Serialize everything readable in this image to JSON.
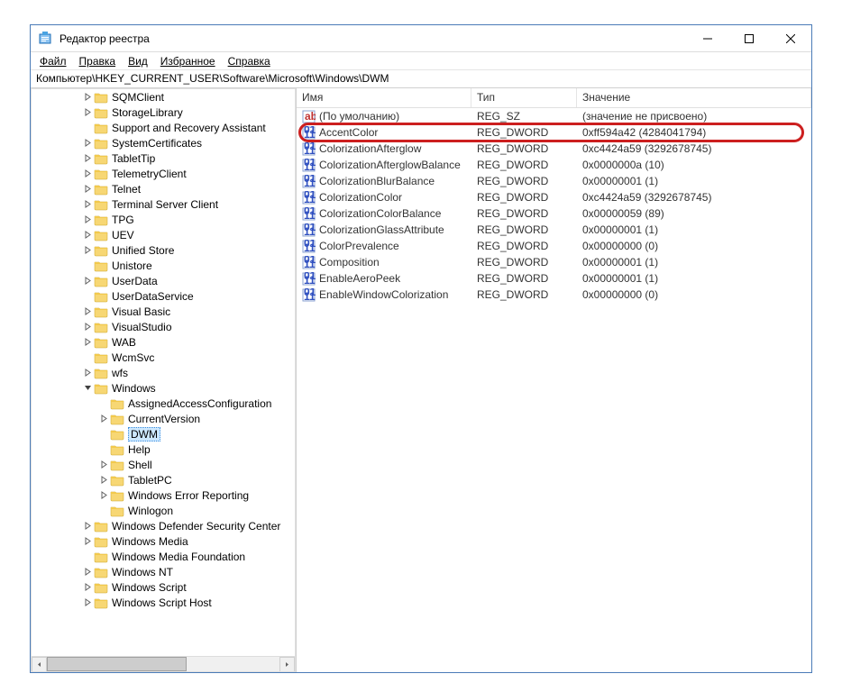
{
  "window": {
    "title": "Редактор реестра"
  },
  "menu": {
    "file": "Файл",
    "edit": "Правка",
    "view": "Вид",
    "favorites": "Избранное",
    "help": "Справка"
  },
  "address": "Компьютер\\HKEY_CURRENT_USER\\Software\\Microsoft\\Windows\\DWM",
  "columns": {
    "name": "Имя",
    "type": "Тип",
    "data": "Значение"
  },
  "tree": {
    "items": [
      {
        "depth": 3,
        "exp": "closed",
        "label": "SQMClient"
      },
      {
        "depth": 3,
        "exp": "closed",
        "label": "StorageLibrary"
      },
      {
        "depth": 3,
        "exp": "leaf",
        "label": "Support and Recovery Assistant"
      },
      {
        "depth": 3,
        "exp": "closed",
        "label": "SystemCertificates"
      },
      {
        "depth": 3,
        "exp": "closed",
        "label": "TabletTip"
      },
      {
        "depth": 3,
        "exp": "closed",
        "label": "TelemetryClient"
      },
      {
        "depth": 3,
        "exp": "closed",
        "label": "Telnet"
      },
      {
        "depth": 3,
        "exp": "closed",
        "label": "Terminal Server Client"
      },
      {
        "depth": 3,
        "exp": "closed",
        "label": "TPG"
      },
      {
        "depth": 3,
        "exp": "closed",
        "label": "UEV"
      },
      {
        "depth": 3,
        "exp": "closed",
        "label": "Unified Store"
      },
      {
        "depth": 3,
        "exp": "leaf",
        "label": "Unistore"
      },
      {
        "depth": 3,
        "exp": "closed",
        "label": "UserData"
      },
      {
        "depth": 3,
        "exp": "leaf",
        "label": "UserDataService"
      },
      {
        "depth": 3,
        "exp": "closed",
        "label": "Visual Basic"
      },
      {
        "depth": 3,
        "exp": "closed",
        "label": "VisualStudio"
      },
      {
        "depth": 3,
        "exp": "closed",
        "label": "WAB"
      },
      {
        "depth": 3,
        "exp": "leaf",
        "label": "WcmSvc"
      },
      {
        "depth": 3,
        "exp": "closed",
        "label": "wfs"
      },
      {
        "depth": 3,
        "exp": "open",
        "label": "Windows"
      },
      {
        "depth": 4,
        "exp": "leaf",
        "label": "AssignedAccessConfiguration"
      },
      {
        "depth": 4,
        "exp": "closed",
        "label": "CurrentVersion"
      },
      {
        "depth": 4,
        "exp": "leaf",
        "label": "DWM",
        "selected": true
      },
      {
        "depth": 4,
        "exp": "leaf",
        "label": "Help"
      },
      {
        "depth": 4,
        "exp": "closed",
        "label": "Shell"
      },
      {
        "depth": 4,
        "exp": "closed",
        "label": "TabletPC"
      },
      {
        "depth": 4,
        "exp": "closed",
        "label": "Windows Error Reporting"
      },
      {
        "depth": 4,
        "exp": "leaf",
        "label": "Winlogon"
      },
      {
        "depth": 3,
        "exp": "closed",
        "label": "Windows Defender Security Center"
      },
      {
        "depth": 3,
        "exp": "closed",
        "label": "Windows Media"
      },
      {
        "depth": 3,
        "exp": "leaf",
        "label": "Windows Media Foundation"
      },
      {
        "depth": 3,
        "exp": "closed",
        "label": "Windows NT"
      },
      {
        "depth": 3,
        "exp": "closed",
        "label": "Windows Script"
      },
      {
        "depth": 3,
        "exp": "closed",
        "label": "Windows Script Host"
      }
    ]
  },
  "values": [
    {
      "icon": "sz",
      "name": "(По умолчанию)",
      "type": "REG_SZ",
      "data": "(значение не присвоено)"
    },
    {
      "icon": "dw",
      "name": "AccentColor",
      "type": "REG_DWORD",
      "data": "0xff594a42 (4284041794)",
      "highlight": true
    },
    {
      "icon": "dw",
      "name": "ColorizationAfterglow",
      "type": "REG_DWORD",
      "data": "0xc4424a59 (3292678745)"
    },
    {
      "icon": "dw",
      "name": "ColorizationAfterglowBalance",
      "type": "REG_DWORD",
      "data": "0x0000000a (10)"
    },
    {
      "icon": "dw",
      "name": "ColorizationBlurBalance",
      "type": "REG_DWORD",
      "data": "0x00000001 (1)"
    },
    {
      "icon": "dw",
      "name": "ColorizationColor",
      "type": "REG_DWORD",
      "data": "0xc4424a59 (3292678745)"
    },
    {
      "icon": "dw",
      "name": "ColorizationColorBalance",
      "type": "REG_DWORD",
      "data": "0x00000059 (89)"
    },
    {
      "icon": "dw",
      "name": "ColorizationGlassAttribute",
      "type": "REG_DWORD",
      "data": "0x00000001 (1)"
    },
    {
      "icon": "dw",
      "name": "ColorPrevalence",
      "type": "REG_DWORD",
      "data": "0x00000000 (0)"
    },
    {
      "icon": "dw",
      "name": "Composition",
      "type": "REG_DWORD",
      "data": "0x00000001 (1)"
    },
    {
      "icon": "dw",
      "name": "EnableAeroPeek",
      "type": "REG_DWORD",
      "data": "0x00000001 (1)"
    },
    {
      "icon": "dw",
      "name": "EnableWindowColorization",
      "type": "REG_DWORD",
      "data": "0x00000000 (0)"
    }
  ]
}
